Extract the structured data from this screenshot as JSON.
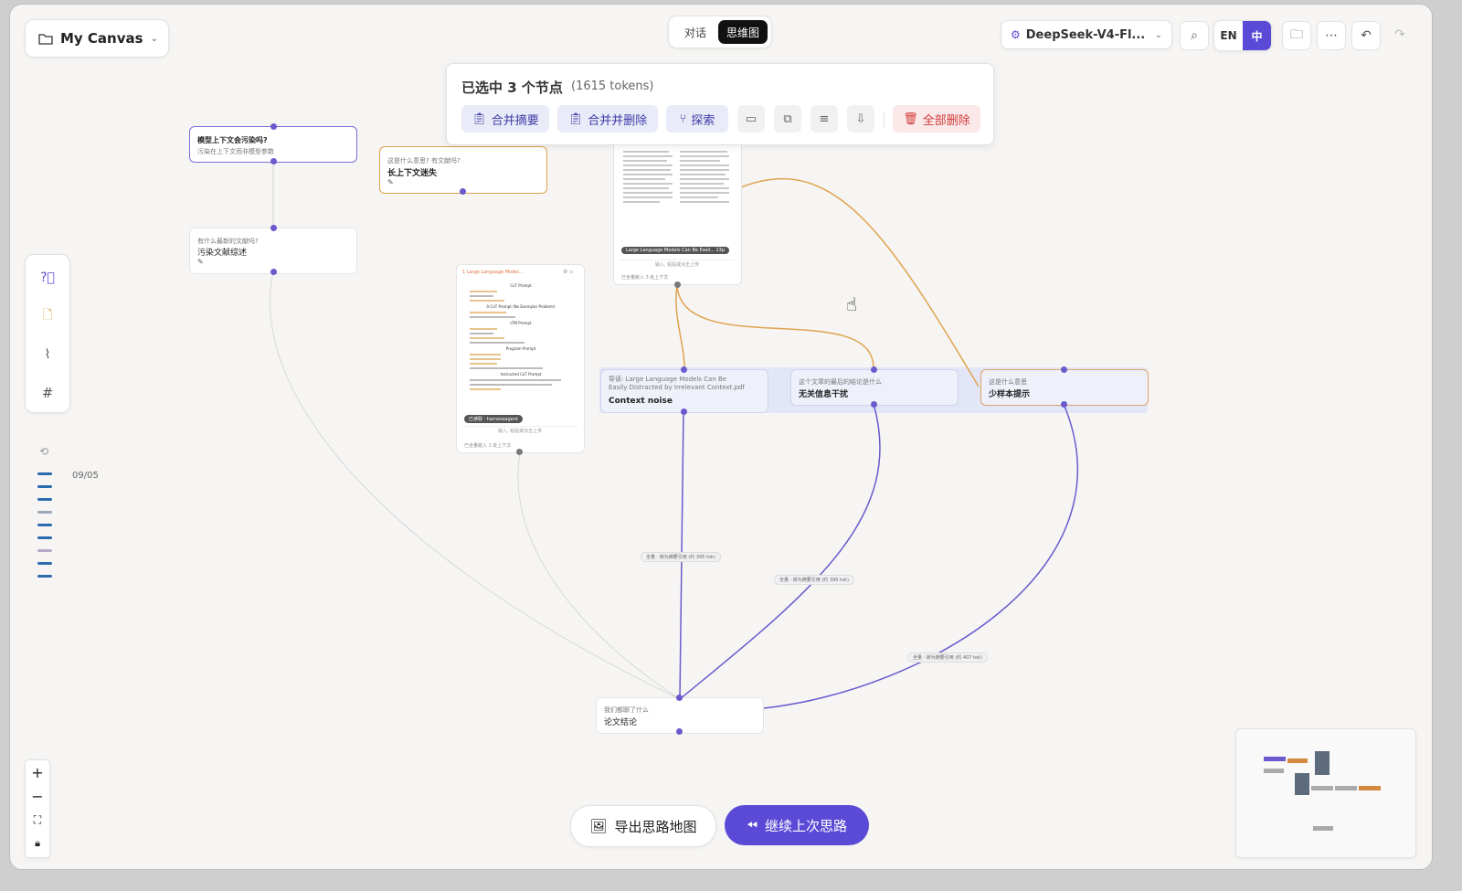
{
  "header": {
    "canvas_title": "My Canvas",
    "view_tabs": [
      "对话",
      "思维图"
    ],
    "active_tab": "思维图",
    "model_name": "DeepSeek-V4-Fl...",
    "lang_en": "EN",
    "lang_zh": "中"
  },
  "selection": {
    "title": "已选中 3 个节点",
    "tokens": "(1615 tokens)",
    "actions": [
      "合并摘要",
      "合并并删除",
      "探索"
    ],
    "delete_all": "全部删除"
  },
  "nodes": {
    "n1": {
      "title": "模型上下文会污染吗?",
      "subtitle": "污染在上下文而非模型参数"
    },
    "n2": {
      "question": "这是什么意思? 有文献吗?",
      "title": "长上下文迷失"
    },
    "n3": {
      "question": "有什么最新的文献吗?",
      "title": "污染文献综述"
    },
    "n4": {
      "question": "导读: Large Language Models Can Be Easily Distracted by Irrelevant Context.pdf",
      "title": "Context noise"
    },
    "n5": {
      "question": "这个文章的最后的结论是什么",
      "title": "无关信息干扰"
    },
    "n6": {
      "question": "这是什么意思",
      "title": "少样本提示"
    },
    "n7": {
      "question": "我们都聊了什么",
      "title": "论文结论"
    }
  },
  "doc_left": {
    "header": "1  Large Language Model...",
    "sections": [
      "CoT Prompt",
      "0-CoT Prompt (No Exemplar Problem)",
      "LTM Prompt",
      "Program Prompt",
      "Instructed CoT Prompt"
    ],
    "tag": "已读取 · harnessagent",
    "input_hint": "输入, 粘贴或点击上传",
    "footer": "已全量嵌入 1 处上下文"
  },
  "doc_right": {
    "tag": "Large Language Models Can Be Easil...  13p",
    "input_hint": "输入, 粘贴或点击上传",
    "footer": "已全量嵌入 3 处上下文"
  },
  "edge_labels": {
    "e1": "全量 · 转为摘要引用 (约 395 tok)",
    "e2": "全量 · 转为摘要引用 (约 395 tok)",
    "e3": "全量 · 转为摘要引用 (约 407 tok)"
  },
  "history": {
    "date": "09/05"
  },
  "bottom": {
    "export": "导出思路地图",
    "continue": "继续上次思路"
  },
  "colors": {
    "accent": "#5b4ad6",
    "orange": "#e0a34e",
    "danger": "#d23b3b"
  }
}
